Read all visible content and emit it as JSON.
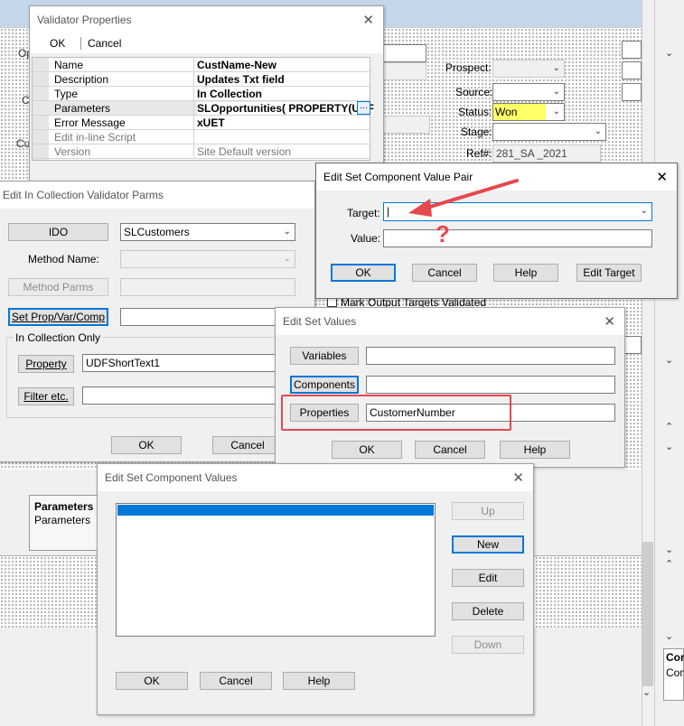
{
  "background": {
    "prospect_label": "Prospect:",
    "source_label": "Source:",
    "status_label": "Status:",
    "status_value": "Won",
    "stage_label": "Stage:",
    "ref_label": "Ref#:",
    "ref_value": "281_SA _2021",
    "mark_output_label": "Mark Output Targets Validated",
    "params_header": "Parameters",
    "params_text": "Parameters",
    "left_cut_labels": [
      "Op",
      "C",
      "Cu"
    ],
    "right_panel_text_1": "Com",
    "right_panel_text_2": "Con"
  },
  "validator_properties": {
    "title": "Validator Properties",
    "ok_label": "OK",
    "cancel_label": "Cancel",
    "rows": [
      {
        "key": "Name",
        "value": "CustName-New"
      },
      {
        "key": "Description",
        "value": "Updates Txt field"
      },
      {
        "key": "Type",
        "value": "In Collection"
      },
      {
        "key": "Parameters",
        "value": "SLOpportunities( PROPERTY(UDF"
      },
      {
        "key": "Error Message",
        "value": "xUET"
      },
      {
        "key": "Edit in-line Script",
        "value": ""
      },
      {
        "key": "Version",
        "value": "Site Default version"
      }
    ]
  },
  "in_collection": {
    "title": "Edit In Collection Validator Parms",
    "ido_label": "IDO",
    "ido_value": "SLCustomers",
    "method_name_label": "Method Name:",
    "method_parms_label": "Method Parms",
    "set_prop_label": "Set Prop/Var/Comp",
    "group_label": "In Collection Only",
    "property_label": "Property",
    "property_value": "UDFShortText1",
    "filter_label": "Filter etc.",
    "ok_label": "OK",
    "cancel_label": "Cancel"
  },
  "value_pair": {
    "title": "Edit Set Component Value Pair",
    "target_label": "Target:",
    "target_value": "|",
    "value_label": "Value:",
    "annotation": "?",
    "ok_label": "OK",
    "cancel_label": "Cancel",
    "help_label": "Help",
    "edit_target_label": "Edit Target",
    "arrow_color": "#e5484d",
    "highlight_color": "#e5484d"
  },
  "set_values": {
    "title": "Edit Set Values",
    "variables_label": "Variables",
    "components_label": "Components",
    "properties_label": "Properties",
    "properties_value": "CustomerNumber",
    "ok_label": "OK",
    "cancel_label": "Cancel",
    "help_label": "Help"
  },
  "component_values": {
    "title": "Edit Set Component Values",
    "up_label": "Up",
    "new_label": "New",
    "edit_label": "Edit",
    "delete_label": "Delete",
    "down_label": "Down",
    "ok_label": "OK",
    "cancel_label": "Cancel",
    "help_label": "Help",
    "selection_color": "#0078d7"
  }
}
